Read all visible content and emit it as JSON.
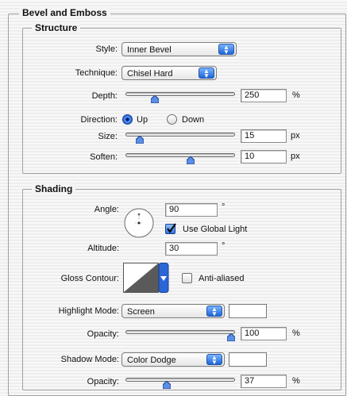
{
  "bevel": {
    "title": "Bevel and Emboss",
    "structure": {
      "title": "Structure",
      "style": {
        "label": "Style:",
        "value": "Inner Bevel"
      },
      "technique": {
        "label": "Technique:",
        "value": "Chisel Hard"
      },
      "depth": {
        "label": "Depth:",
        "value": "250",
        "unit": "%",
        "level": 0.25
      },
      "direction": {
        "label": "Direction:",
        "options": [
          "Up",
          "Down"
        ],
        "selected": "Up"
      },
      "size": {
        "label": "Size:",
        "value": "15",
        "unit": "px",
        "level": 0.1
      },
      "soften": {
        "label": "Soften:",
        "value": "10",
        "unit": "px",
        "level": 0.6
      }
    },
    "shading": {
      "title": "Shading",
      "angle": {
        "label": "Angle:",
        "value": "90",
        "unit": "°"
      },
      "global_light": {
        "label": "Use Global Light",
        "checked": true
      },
      "altitude": {
        "label": "Altitude:",
        "value": "30",
        "unit": "°"
      },
      "gloss_contour": {
        "label": "Gloss Contour:"
      },
      "anti_aliased": {
        "label": "Anti-aliased",
        "checked": false
      },
      "highlight_mode": {
        "label": "Highlight Mode:",
        "value": "Screen",
        "color": "#ffffff"
      },
      "highlight_opacity": {
        "label": "Opacity:",
        "value": "100",
        "unit": "%",
        "level": 1.0
      },
      "shadow_mode": {
        "label": "Shadow Mode:",
        "value": "Color Dodge",
        "color": "#ffffff"
      },
      "shadow_opacity": {
        "label": "Opacity:",
        "value": "37",
        "unit": "%",
        "level": 0.37
      }
    }
  }
}
